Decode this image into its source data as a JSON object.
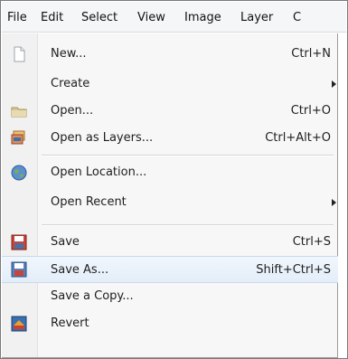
{
  "menubar": {
    "items": [
      {
        "label": "File",
        "key": "F"
      },
      {
        "label": "Edit",
        "key": "E"
      },
      {
        "label": "Select",
        "key": "S"
      },
      {
        "label": "View",
        "key": "V"
      },
      {
        "label": "Image",
        "key": "I"
      },
      {
        "label": "Layer",
        "key": "L"
      },
      {
        "label": "C",
        "key": ""
      }
    ]
  },
  "file_menu": {
    "items": [
      {
        "label": "New...",
        "accel": "Ctrl+N",
        "icon": "new-document-icon"
      },
      {
        "label": "Create",
        "accel": "",
        "submenu": true,
        "icon": ""
      },
      {
        "label": "Open...",
        "accel": "Ctrl+O",
        "icon": "open-folder-icon"
      },
      {
        "label": "Open as Layers...",
        "accel": "Ctrl+Alt+O",
        "icon": "open-as-layers-icon"
      },
      {
        "label": "Open Location...",
        "accel": "",
        "icon": "globe-icon"
      },
      {
        "label": "Open Recent",
        "accel": "",
        "submenu": true,
        "icon": ""
      },
      {
        "label": "Save",
        "accel": "Ctrl+S",
        "icon": "save-icon"
      },
      {
        "label": "Save As...",
        "accel": "Shift+Ctrl+S",
        "icon": "save-as-icon",
        "highlighted": true
      },
      {
        "label": "Save a Copy...",
        "accel": "",
        "icon": ""
      },
      {
        "label": "Revert",
        "accel": "",
        "icon": "revert-icon"
      }
    ]
  },
  "colors": {
    "highlight": "#e3eef9",
    "menu_bg": "#f7f7f7",
    "menubar_bg": "#f4f6f8"
  }
}
